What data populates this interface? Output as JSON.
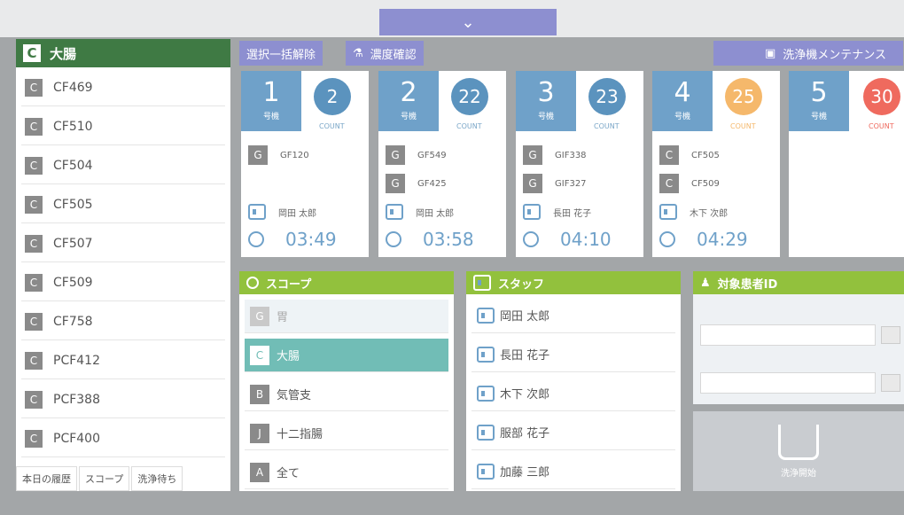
{
  "collapse_icon": "chevron-down-icon",
  "left_list": {
    "header_badge": "C",
    "header_label": "大腸",
    "items": [
      {
        "badge": "C",
        "label": "CF469"
      },
      {
        "badge": "C",
        "label": "CF510"
      },
      {
        "badge": "C",
        "label": "CF504"
      },
      {
        "badge": "C",
        "label": "CF505"
      },
      {
        "badge": "C",
        "label": "CF507"
      },
      {
        "badge": "C",
        "label": "CF509"
      },
      {
        "badge": "C",
        "label": "CF758"
      },
      {
        "badge": "C",
        "label": "PCF412"
      },
      {
        "badge": "C",
        "label": "PCF388"
      },
      {
        "badge": "C",
        "label": "PCF400"
      }
    ],
    "tabs": [
      "本日の履歴",
      "スコープ",
      "洗浄待ち"
    ]
  },
  "toolbar": {
    "deselect_all": "選択一括解除",
    "concentration_check": "濃度確認",
    "washer_maintenance": "洗浄機メンテナンス"
  },
  "machines": [
    {
      "number": "1",
      "unit_label": "号機",
      "count": "2",
      "count_label": "COUNT",
      "count_color": "#5b93be",
      "scopes": [
        {
          "badge": "G",
          "code": "GF120"
        }
      ],
      "staff": "岡田 太郎",
      "time": "03:49"
    },
    {
      "number": "2",
      "unit_label": "号機",
      "count": "22",
      "count_label": "COUNT",
      "count_color": "#5b93be",
      "scopes": [
        {
          "badge": "G",
          "code": "GF549"
        },
        {
          "badge": "G",
          "code": "GF425"
        }
      ],
      "staff": "岡田 太郎",
      "time": "03:58"
    },
    {
      "number": "3",
      "unit_label": "号機",
      "count": "23",
      "count_label": "COUNT",
      "count_color": "#5b93be",
      "scopes": [
        {
          "badge": "G",
          "code": "GIF338"
        },
        {
          "badge": "G",
          "code": "GIF327"
        }
      ],
      "staff": "長田 花子",
      "time": "04:10"
    },
    {
      "number": "4",
      "unit_label": "号機",
      "count": "25",
      "count_label": "COUNT",
      "count_color": "#f5b86b",
      "scopes": [
        {
          "badge": "C",
          "code": "CF505"
        },
        {
          "badge": "C",
          "code": "CF509"
        }
      ],
      "staff": "木下 次郎",
      "time": "04:29"
    },
    {
      "number": "5",
      "unit_label": "号機",
      "count": "30",
      "count_label": "COUNT",
      "count_color": "#ef6a5e",
      "scopes": [],
      "staff": "",
      "time": ""
    }
  ],
  "scope_panel": {
    "title": "スコープ",
    "items": [
      {
        "badge": "G",
        "label": "胃"
      },
      {
        "badge": "C",
        "label": "大腸"
      },
      {
        "badge": "B",
        "label": "気管支"
      },
      {
        "badge": "J",
        "label": "十二指腸"
      },
      {
        "badge": "A",
        "label": "全て"
      }
    ]
  },
  "staff_panel": {
    "title": "スタッフ",
    "items": [
      "岡田 太郎",
      "長田 花子",
      "木下 次郎",
      "服部 花子",
      "加藤 三郎"
    ]
  },
  "patient_panel": {
    "title": "対象患者ID",
    "start_wash": "洗浄開始"
  },
  "colors": {
    "accent_purple": "#8d8fd0",
    "machine_blue": "#6fa1c9",
    "panel_green": "#92c13d",
    "header_green": "#3f7a44",
    "selected_teal": "#71bdb6"
  }
}
